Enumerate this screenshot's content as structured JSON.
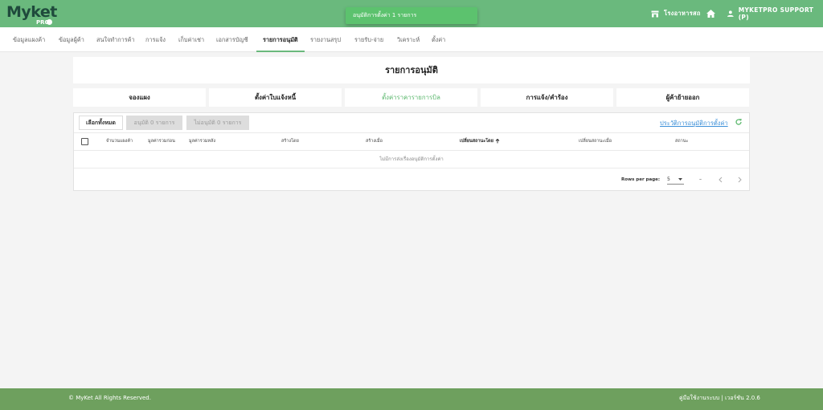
{
  "header": {
    "logo_text": "Myket",
    "logo_sub": "PRO",
    "toast": "อนุมัติการตั้งค่า 1 รายการ",
    "store_name": "โรงอาหารสถ",
    "user": "MYKETPRO SUPPORT (P)"
  },
  "nav": {
    "items": [
      {
        "label": "ข้อมูลแผงค้า"
      },
      {
        "label": "ข้อมูลผู้ค้า"
      },
      {
        "label": "สนใจทำการค้า"
      },
      {
        "label": "การแจ้ง"
      },
      {
        "label": "เก็บค่าเช่า"
      },
      {
        "label": "เอกสารบัญชี"
      },
      {
        "label": "รายการอนุมัติ"
      },
      {
        "label": "รายงานสรุป"
      },
      {
        "label": "รายรับ-จ่าย"
      },
      {
        "label": "วิเคราะห์"
      },
      {
        "label": "ตั้งค่า"
      }
    ],
    "active_index": 6
  },
  "page": {
    "title": "รายการอนุมัติ"
  },
  "tabs": [
    {
      "label": "จองแผง"
    },
    {
      "label": "ตั้งค่าใบแจ้งหนี้"
    },
    {
      "label": "ตั้งค่าราคารายการบิล"
    },
    {
      "label": "การแจ้ง/คำร้อง"
    },
    {
      "label": "ผู้ค้าย้ายออก"
    }
  ],
  "active_tab": 2,
  "toolbar": {
    "select_all": "เลือกทั้งหมด",
    "approve": "อนุมัติ 0 รายการ",
    "reject": "ไม่อนุมัติ 0 รายการ",
    "history_link": "ประวัติการอนุมัติการตั้งค่า"
  },
  "table": {
    "columns": [
      {
        "label": "จำนวนแผงค้า"
      },
      {
        "label": "มูลค่ารวมก่อน"
      },
      {
        "label": "มูลค่ารวมหลัง"
      },
      {
        "label": "สร้างโดย"
      },
      {
        "label": "สร้างเมื่อ"
      },
      {
        "label": "เปลี่ยนสถานะโดย"
      },
      {
        "label": "เปลี่ยนสถานะเมื่อ"
      },
      {
        "label": "สถานะ"
      }
    ],
    "sorted_column": 5,
    "empty_message": "ไม่มีการส่งเรื่องอนุมัติการตั้งค่า"
  },
  "pagination": {
    "rows_per_page_label": "Rows per page:",
    "rows_per_page": "5",
    "range": "–"
  },
  "footer": {
    "copyright": "© MyKet All Rights Reserved.",
    "right": "คู่มือใช้งานระบบ | เวอร์ชัน 2.0.6"
  },
  "colors": {
    "header_green": "#6ab97d",
    "toast_green": "#5cc26e",
    "footer_green": "#6ea05e",
    "link_blue": "#3b8fd8"
  }
}
